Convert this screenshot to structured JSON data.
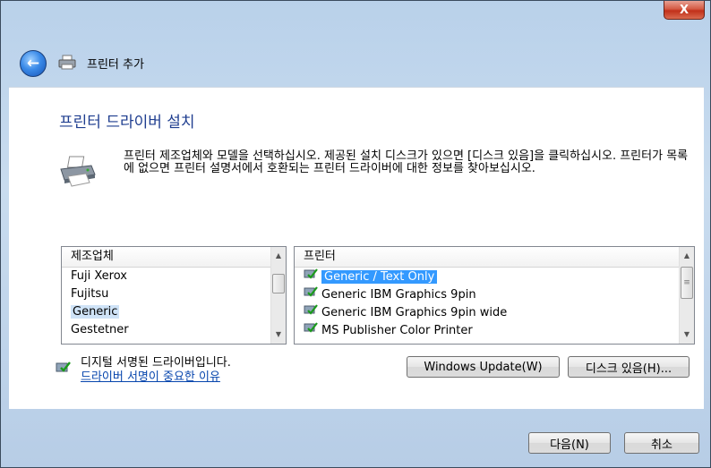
{
  "window": {
    "close_label": "X"
  },
  "nav": {
    "title": "프린터 추가"
  },
  "page": {
    "title": "프린터 드라이버 설치",
    "description": "프린터 제조업체와 모델을 선택하십시오. 제공된 설치 디스크가 있으면 [디스크 있음]을 클릭하십시오. 프린터가 목록에 없으면 프린터 설명서에서 호환되는 프린터 드라이버에 대한 정보를 찾아보십시오."
  },
  "manufacturers": {
    "header": "제조업체",
    "items": [
      "Fuji Xerox",
      "Fujitsu",
      "Generic",
      "Gestetner"
    ],
    "selected_index": 2
  },
  "printers": {
    "header": "프린터",
    "items": [
      "Generic / Text Only",
      "Generic IBM Graphics 9pin",
      "Generic IBM Graphics 9pin wide",
      "MS Publisher Color Printer"
    ],
    "selected_index": 0
  },
  "signature": {
    "text": "디지털 서명된 드라이버입니다.",
    "link": "드라이버 서명이 중요한 이유"
  },
  "buttons": {
    "windows_update": "Windows Update(W)",
    "have_disk": "디스크 있음(H)...",
    "next": "다음(N)",
    "cancel": "취소"
  },
  "colors": {
    "title_blue": "#1e3d8f",
    "selection_blue": "#3399ff",
    "link_blue": "#0645ad",
    "frame_blue": "#b9d1ea"
  },
  "icons": {
    "close": "close-icon",
    "back": "back-arrow-icon",
    "printer": "printer-icon",
    "driver": "signed-driver-icon"
  }
}
